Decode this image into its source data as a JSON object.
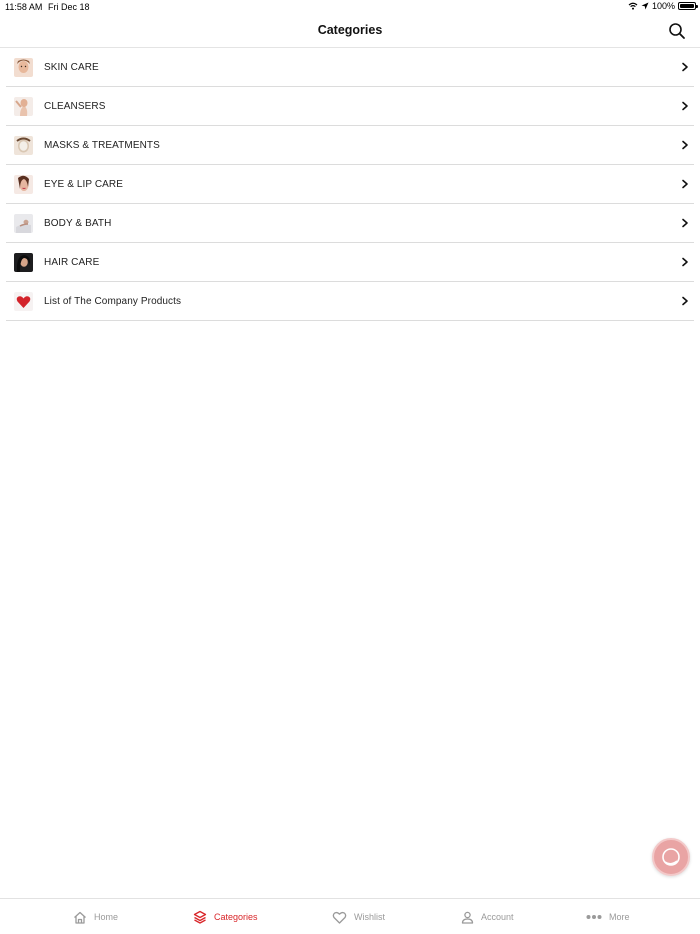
{
  "status_bar": {
    "time": "11:58 AM",
    "date": "Fri Dec 18",
    "battery": "100%"
  },
  "header": {
    "title": "Categories",
    "search_icon": "search-icon"
  },
  "categories": [
    {
      "label": "SKIN CARE",
      "icon": "skin-care-thumbnail"
    },
    {
      "label": "CLEANSERS",
      "icon": "cleansers-thumbnail"
    },
    {
      "label": "MASKS & TREATMENTS",
      "icon": "masks-thumbnail"
    },
    {
      "label": "EYE & LIP CARE",
      "icon": "eye-lip-thumbnail"
    },
    {
      "label": "BODY & BATH",
      "icon": "body-bath-thumbnail"
    },
    {
      "label": "HAIR CARE",
      "icon": "hair-care-thumbnail"
    },
    {
      "label": "List of The Company Products",
      "icon": "company-products-thumbnail"
    }
  ],
  "tab_bar": {
    "tabs": [
      {
        "label": "Home",
        "icon": "home-icon",
        "active": false
      },
      {
        "label": "Categories",
        "icon": "layers-icon",
        "active": true
      },
      {
        "label": "Wishlist",
        "icon": "heart-icon",
        "active": false
      },
      {
        "label": "Account",
        "icon": "person-icon",
        "active": false
      },
      {
        "label": "More",
        "icon": "more-dots-icon",
        "active": false
      }
    ]
  },
  "colors": {
    "accent": "#d9262a",
    "inactive_tab": "#9a9a9a",
    "fab": "#e9a4a4"
  }
}
